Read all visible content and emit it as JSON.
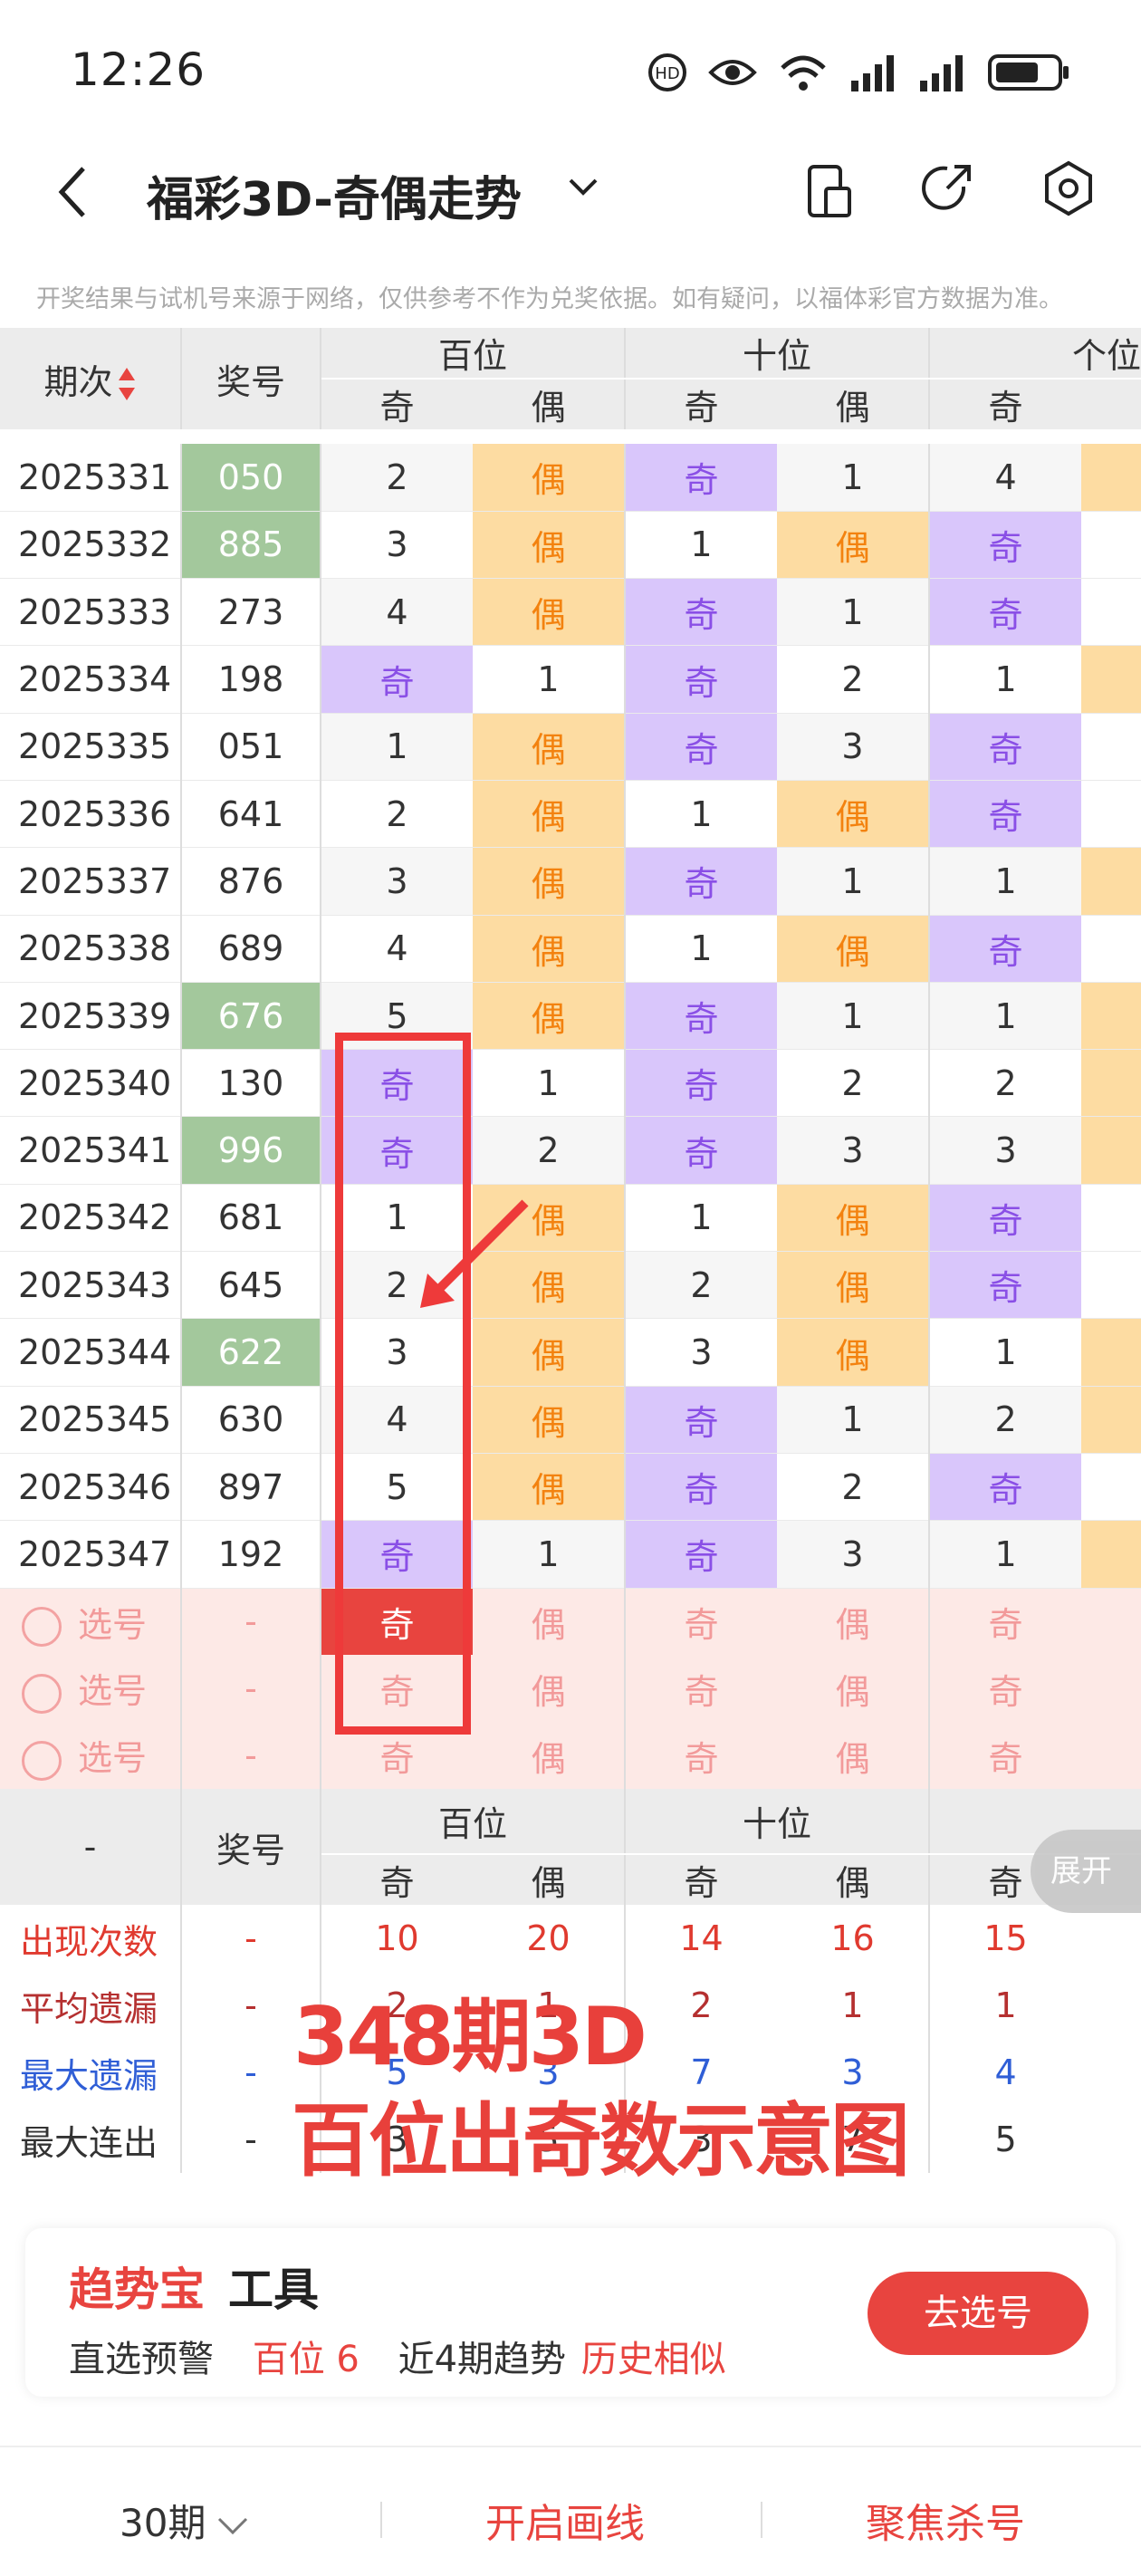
{
  "status": {
    "time": "12:26"
  },
  "header": {
    "title": "福彩3D-奇偶走势",
    "notice": "开奖结果与试机号来源于网络，仅供参考不作为兑奖依据。如有疑问，以福体彩官方数据为准。"
  },
  "table": {
    "period_header": "期次",
    "number_header": "奖号",
    "groups": [
      "百位",
      "十位",
      "个位"
    ],
    "odd_label": "奇",
    "even_label": "偶",
    "rows": [
      {
        "period": "2025331",
        "number": "050",
        "highlight": true,
        "cells": [
          "2",
          "偶",
          "奇",
          "1",
          "4",
          ""
        ],
        "types": [
          "n",
          "e",
          "o",
          "n",
          "n",
          "e"
        ]
      },
      {
        "period": "2025332",
        "number": "885",
        "highlight": true,
        "cells": [
          "3",
          "偶",
          "1",
          "偶",
          "奇",
          ""
        ],
        "types": [
          "n",
          "e",
          "n",
          "e",
          "o",
          "n"
        ]
      },
      {
        "period": "2025333",
        "number": "273",
        "highlight": false,
        "cells": [
          "4",
          "偶",
          "奇",
          "1",
          "奇",
          ""
        ],
        "types": [
          "n",
          "e",
          "o",
          "n",
          "o",
          "n"
        ]
      },
      {
        "period": "2025334",
        "number": "198",
        "highlight": false,
        "cells": [
          "奇",
          "1",
          "奇",
          "2",
          "1",
          ""
        ],
        "types": [
          "o",
          "n",
          "o",
          "n",
          "n",
          "e"
        ]
      },
      {
        "period": "2025335",
        "number": "051",
        "highlight": false,
        "cells": [
          "1",
          "偶",
          "奇",
          "3",
          "奇",
          ""
        ],
        "types": [
          "n",
          "e",
          "o",
          "n",
          "o",
          "n"
        ]
      },
      {
        "period": "2025336",
        "number": "641",
        "highlight": false,
        "cells": [
          "2",
          "偶",
          "1",
          "偶",
          "奇",
          ""
        ],
        "types": [
          "n",
          "e",
          "n",
          "e",
          "o",
          "n"
        ]
      },
      {
        "period": "2025337",
        "number": "876",
        "highlight": false,
        "cells": [
          "3",
          "偶",
          "奇",
          "1",
          "1",
          ""
        ],
        "types": [
          "n",
          "e",
          "o",
          "n",
          "n",
          "e"
        ]
      },
      {
        "period": "2025338",
        "number": "689",
        "highlight": false,
        "cells": [
          "4",
          "偶",
          "1",
          "偶",
          "奇",
          ""
        ],
        "types": [
          "n",
          "e",
          "n",
          "e",
          "o",
          "n"
        ]
      },
      {
        "period": "2025339",
        "number": "676",
        "highlight": true,
        "cells": [
          "5",
          "偶",
          "奇",
          "1",
          "1",
          ""
        ],
        "types": [
          "n",
          "e",
          "o",
          "n",
          "n",
          "e"
        ]
      },
      {
        "period": "2025340",
        "number": "130",
        "highlight": false,
        "cells": [
          "奇",
          "1",
          "奇",
          "2",
          "2",
          ""
        ],
        "types": [
          "o",
          "n",
          "o",
          "n",
          "n",
          "e"
        ]
      },
      {
        "period": "2025341",
        "number": "996",
        "highlight": true,
        "cells": [
          "奇",
          "2",
          "奇",
          "3",
          "3",
          ""
        ],
        "types": [
          "o",
          "n",
          "o",
          "n",
          "n",
          "e"
        ]
      },
      {
        "period": "2025342",
        "number": "681",
        "highlight": false,
        "cells": [
          "1",
          "偶",
          "1",
          "偶",
          "奇",
          ""
        ],
        "types": [
          "n",
          "e",
          "n",
          "e",
          "o",
          "n"
        ]
      },
      {
        "period": "2025343",
        "number": "645",
        "highlight": false,
        "cells": [
          "2",
          "偶",
          "2",
          "偶",
          "奇",
          ""
        ],
        "types": [
          "n",
          "e",
          "n",
          "e",
          "o",
          "n"
        ]
      },
      {
        "period": "2025344",
        "number": "622",
        "highlight": true,
        "cells": [
          "3",
          "偶",
          "3",
          "偶",
          "1",
          ""
        ],
        "types": [
          "n",
          "e",
          "n",
          "e",
          "n",
          "e"
        ]
      },
      {
        "period": "2025345",
        "number": "630",
        "highlight": false,
        "cells": [
          "4",
          "偶",
          "奇",
          "1",
          "2",
          ""
        ],
        "types": [
          "n",
          "e",
          "o",
          "n",
          "n",
          "e"
        ]
      },
      {
        "period": "2025346",
        "number": "897",
        "highlight": false,
        "cells": [
          "5",
          "偶",
          "奇",
          "2",
          "奇",
          ""
        ],
        "types": [
          "n",
          "e",
          "o",
          "n",
          "o",
          "n"
        ]
      },
      {
        "period": "2025347",
        "number": "192",
        "highlight": false,
        "cells": [
          "奇",
          "1",
          "奇",
          "3",
          "1",
          ""
        ],
        "types": [
          "o",
          "n",
          "o",
          "n",
          "n",
          "e"
        ]
      }
    ],
    "selection_rows": [
      {
        "label": "选号",
        "number": "-",
        "cells": [
          "奇",
          "偶",
          "奇",
          "偶",
          "奇"
        ],
        "active": [
          true,
          false,
          false,
          false,
          false
        ]
      },
      {
        "label": "选号",
        "number": "-",
        "cells": [
          "奇",
          "偶",
          "奇",
          "偶",
          "奇"
        ],
        "active": [
          false,
          false,
          false,
          false,
          false
        ]
      },
      {
        "label": "选号",
        "number": "-",
        "cells": [
          "奇",
          "偶",
          "奇",
          "偶",
          "奇"
        ],
        "active": [
          false,
          false,
          false,
          false,
          false
        ]
      }
    ]
  },
  "stats": {
    "dash": "-",
    "expand": "展开",
    "rows": [
      {
        "label": "出现次数",
        "number": "-",
        "values": [
          "10",
          "20",
          "14",
          "16",
          "15"
        ],
        "color": "bold-red"
      },
      {
        "label": "平均遗漏",
        "number": "-",
        "values": [
          "2",
          "1",
          "2",
          "1",
          "1"
        ],
        "color": "dark-red"
      },
      {
        "label": "最大遗漏",
        "number": "-",
        "values": [
          "5",
          "3",
          "7",
          "3",
          "4"
        ],
        "color": "blue"
      },
      {
        "label": "最大连出",
        "number": "-",
        "values": [
          "3",
          "5",
          "3",
          "7",
          "5"
        ],
        "color": "dark"
      }
    ]
  },
  "overlay": {
    "line1": "348期3D",
    "line2": "百位出奇数示意图"
  },
  "tool": {
    "brand": "趋势宝",
    "label": "工具",
    "item1": "直选预警",
    "item2": "百位 6",
    "item3": "近4期趋势",
    "item4": "历史相似",
    "button": "去选号"
  },
  "bottom": {
    "periods": "30期",
    "draw": "开启画线",
    "focus": "聚焦杀号"
  }
}
